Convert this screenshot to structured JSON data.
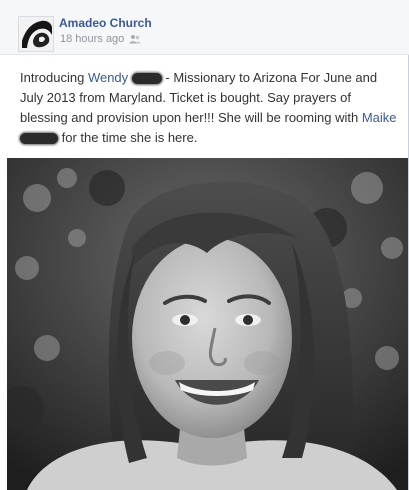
{
  "post": {
    "page_name": "Amadeo Church",
    "timestamp": "18 hours ago",
    "privacy_icon": "friends-icon",
    "message": {
      "intro": "Introducing ",
      "tagged_person_1": "Wendy",
      "line_mid": " - Missionary to Arizona For June and July 2013 from Maryland. Ticket is bought. Say prayers of blessing and provision upon her!!! She will be rooming with ",
      "tagged_person_2": "Maike",
      "line_end": " for the time she is here."
    },
    "photo": {
      "style": "black-and-white portrait"
    }
  },
  "colors": {
    "link": "#3b5998",
    "text": "#333333",
    "meta": "#90949c",
    "header_bg": "#f6f7f9"
  }
}
